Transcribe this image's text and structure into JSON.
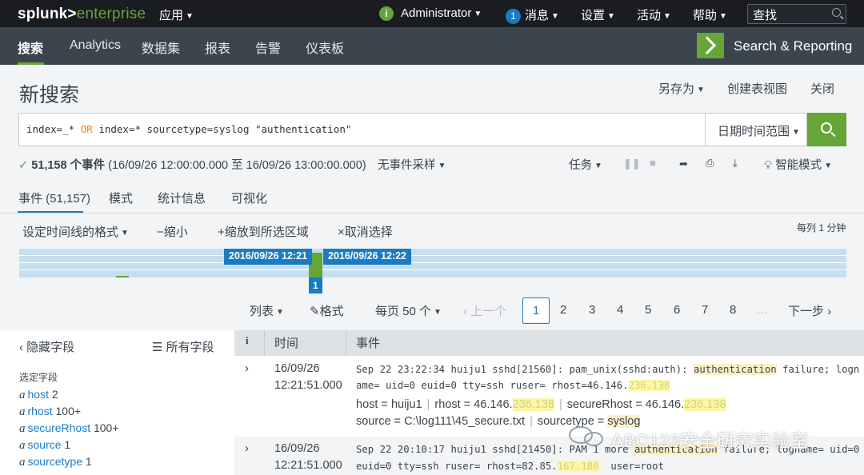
{
  "topbar": {
    "logo_brand": "splunk>",
    "logo_product": "enterprise",
    "apps_menu": "应用",
    "status_icon": "i",
    "user_menu": "Administrator",
    "messages_count": "1",
    "messages_menu": "消息",
    "settings_menu": "设置",
    "activity_menu": "活动",
    "help_menu": "帮助",
    "find_label": "查找"
  },
  "nav": {
    "items": [
      "搜索",
      "Analytics",
      "数据集",
      "报表",
      "告警",
      "仪表板"
    ],
    "app_name": "Search & Reporting",
    "accent_color": "#65a637"
  },
  "header": {
    "title": "新搜索",
    "save_as": "另存为",
    "create_table_view": "创建表视图",
    "close": "关闭"
  },
  "search": {
    "query_prefix": "index=_* ",
    "query_operator": "OR",
    "query_suffix": " index=* sourcetype=syslog \"authentication\"",
    "time_range_picker": "日期时间范围"
  },
  "status": {
    "event_count": "51,158 个事件",
    "time_span": "(16/09/26 12:00:00.000 至 16/09/26 13:00:00.000)",
    "sampling": "无事件采样",
    "jobs": "任务",
    "mode": "智能模式"
  },
  "tabs": [
    "事件 (51,157)",
    "模式",
    "统计信息",
    "可视化"
  ],
  "timeline": {
    "format_menu": "设定时间线的格式",
    "zoom_out": "缩小",
    "zoom_to_selection": "缩放到所选区域",
    "deselect": "取消选择",
    "scale": "每列 1 分钟",
    "tooltip_start": "2016/09/26 12:21",
    "tooltip_end": "2016/09/26 12:22",
    "selected_count": "1 r"
  },
  "pager": {
    "list_menu": "列表",
    "format_menu": "格式",
    "per_page": "每页 50 个",
    "prev": "上一个",
    "pages": [
      "1",
      "2",
      "3",
      "4",
      "5",
      "6",
      "7",
      "8"
    ],
    "ellipsis": "...",
    "next": "下一步"
  },
  "sidebar": {
    "hide_fields": "隐藏字段",
    "all_fields": "所有字段",
    "selected_fields_caption": "选定字段",
    "fields": [
      {
        "type": "a",
        "name": "host",
        "count": "2"
      },
      {
        "type": "a",
        "name": "rhost",
        "count": "100+"
      },
      {
        "type": "a",
        "name": "secureRhost",
        "count": "100+"
      },
      {
        "type": "a",
        "name": "source",
        "count": "1"
      },
      {
        "type": "a",
        "name": "sourcetype",
        "count": "1"
      }
    ]
  },
  "grid": {
    "col_info": "i",
    "col_time": "时间",
    "col_event": "事件"
  },
  "events": [
    {
      "date": "16/09/26",
      "time": "12:21:51.000",
      "raw_line1_prefix": "Sep 22 23:22:34 huiju1 sshd[21560]: pam_unix(sshd:auth): ",
      "raw_line1_highlight": "authentication",
      "raw_line1_suffix": " failure; logn",
      "raw_line2_prefix": "ame= uid=0 euid=0 tty=ssh ruser= rhost=46.146.",
      "raw_line2_masked": "236.138",
      "host_label": "host =",
      "host_value": "huiju1",
      "rhost_label": "rhost =",
      "rhost_value": "46.146.",
      "rhost_masked": "236.138",
      "secure_label": "secureRhost =",
      "secure_value": "46.146.",
      "secure_masked": "236.138",
      "source_label": "source =",
      "source_value": "C:\\log111\\45_secure.txt",
      "sourcetype_label": "sourcetype =",
      "sourcetype_value": "syslog"
    },
    {
      "date": "16/09/26",
      "time": "12:21:51.000",
      "raw_line1_prefix": "Sep 22 20:10:17 huiju1 sshd[21450]: PAM 1 more ",
      "raw_line1_highlight": "authentication",
      "raw_line1_suffix": " failure; logname= uid=0",
      "raw_line2_prefix": "euid=0 tty=ssh ruser= rhost=82.85.",
      "raw_line2_masked": "167.180",
      "raw_line2_suffix": "  user=root"
    }
  ],
  "watermark": "ABC123安全研究实验室"
}
